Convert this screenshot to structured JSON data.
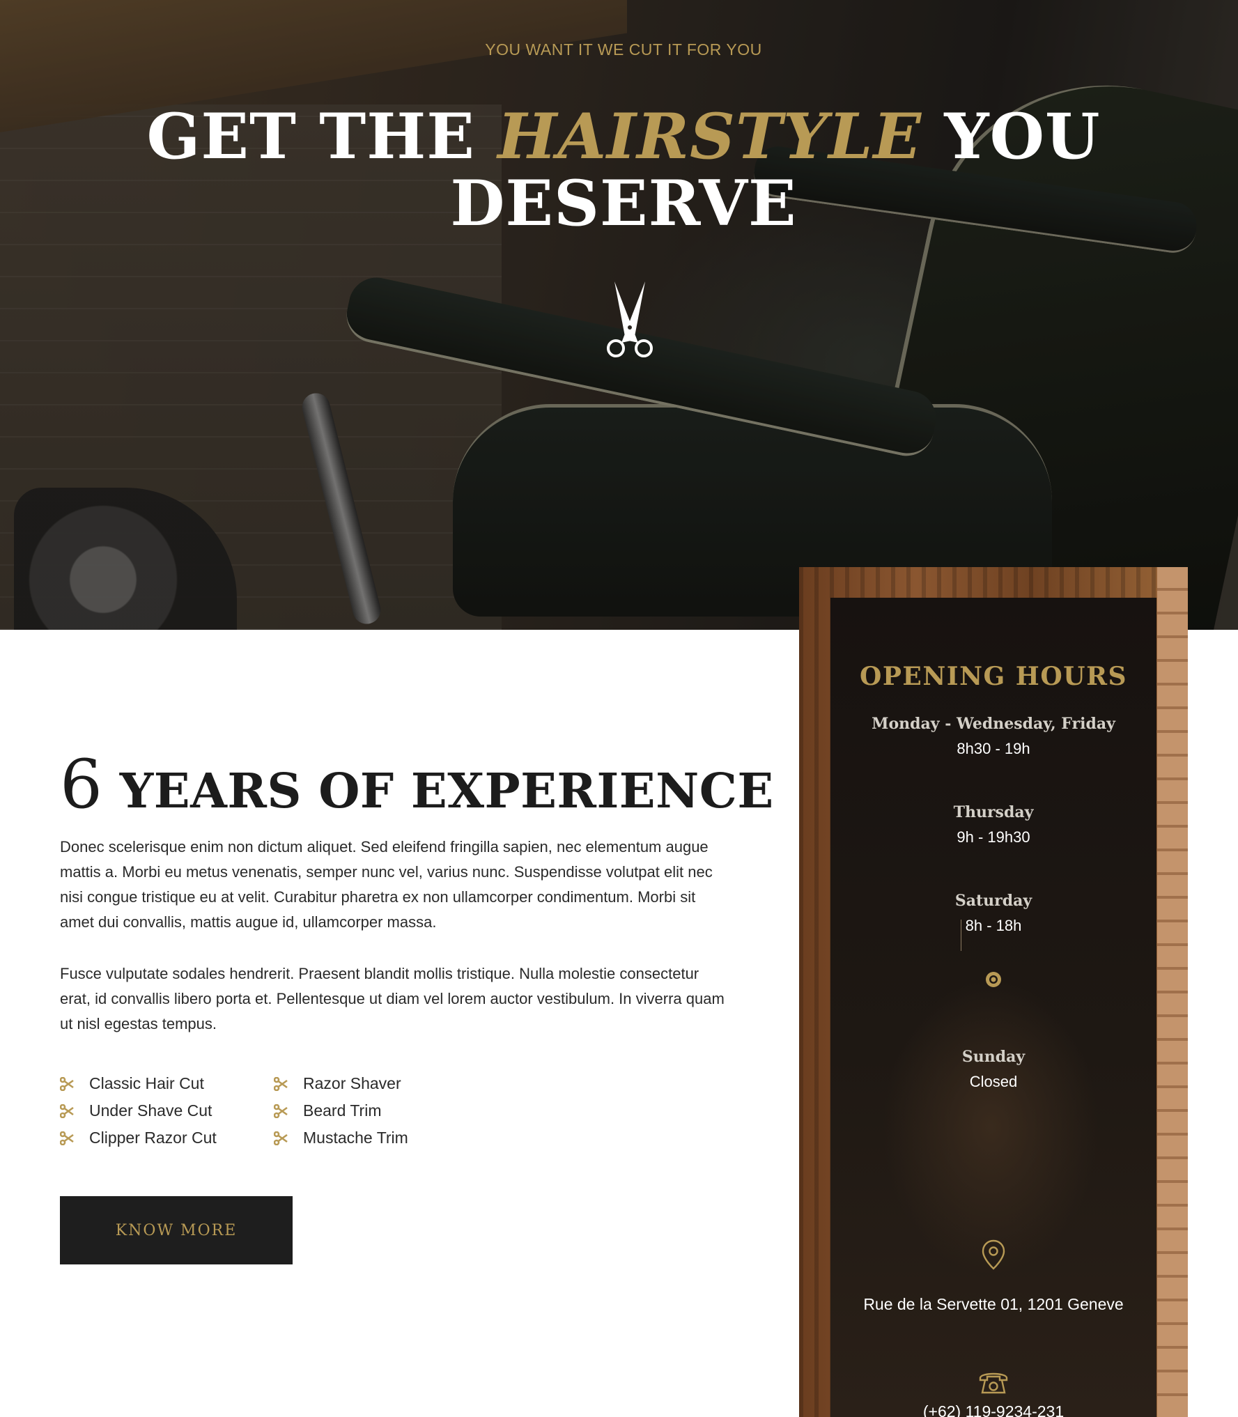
{
  "hero": {
    "tagline": "YOU WANT IT WE CUT IT FOR YOU",
    "headline_part1": "GET THE ",
    "headline_accent": "HAIRSTYLE",
    "headline_part2": " YOU",
    "headline_line2": "DESERVE",
    "icon": "scissors-icon"
  },
  "about": {
    "years_number": "6",
    "title": "YEARS OF EXPERIENCE",
    "paragraph1": "Donec scelerisque enim non dictum aliquet. Sed eleifend fringilla sapien, nec elementum augue mattis a. Morbi eu metus venenatis, semper nunc vel, varius nunc. Suspendisse volutpat elit nec nisi congue tristique eu at velit. Curabitur pharetra ex non ullamcorper condimentum. Morbi sit amet dui convallis, mattis augue id, ullamcorper massa.",
    "paragraph2": "Fusce vulputate sodales hendrerit. Praesent blandit mollis tristique. Nulla molestie consectetur erat, id convallis libero porta et. Pellentesque ut diam vel lorem auctor vestibulum. In viverra quam ut nisl egestas tempus.",
    "services": [
      "Classic Hair Cut",
      "Razor Shaver",
      "Under Shave Cut",
      "Beard Trim",
      "Clipper Razor Cut",
      "Mustache Trim"
    ],
    "service_icon": "scissors-icon",
    "button_label": "KNOW MORE"
  },
  "hours": {
    "title": "OPENING HOURS",
    "slots": [
      {
        "day": "Monday - Wednesday, Friday",
        "time": "8h30 - 19h"
      },
      {
        "day": "Thursday",
        "time": "9h - 19h30"
      },
      {
        "day": "Saturday",
        "time": "8h - 18h"
      },
      {
        "day": "Sunday",
        "time": "Closed"
      }
    ],
    "address": "Rue de la Servette 01, 1201 Geneve",
    "address_icon": "location-pin-icon",
    "phone": "(+62) 119-9234-231",
    "phone_icon": "phone-icon"
  },
  "colors": {
    "accent_gold": "#b89a55",
    "dark": "#1e1e1e",
    "text": "#2a2a2a"
  }
}
